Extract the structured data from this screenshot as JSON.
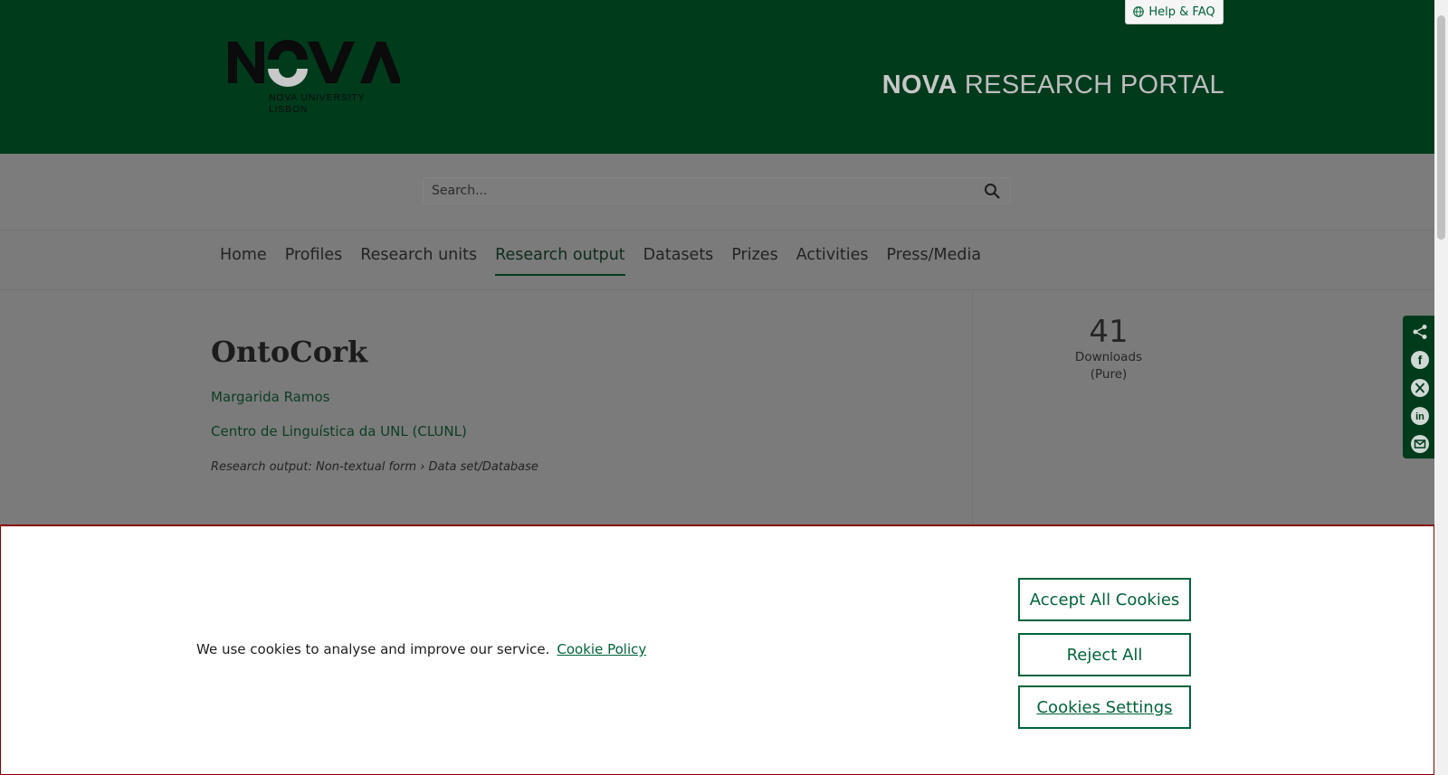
{
  "header": {
    "help_label": "Help & FAQ",
    "logo_text": "NOVA",
    "logo_sub_line1": "NOVA UNIVERSITY",
    "logo_sub_line2": "LISBON",
    "portal_title_bold": "NOVA",
    "portal_title_rest": " RESEARCH PORTAL"
  },
  "search": {
    "placeholder": "Search..."
  },
  "nav": {
    "items": [
      {
        "label": "Home"
      },
      {
        "label": "Profiles"
      },
      {
        "label": "Research units"
      },
      {
        "label": "Research output",
        "active": true
      },
      {
        "label": "Datasets"
      },
      {
        "label": "Prizes"
      },
      {
        "label": "Activities"
      },
      {
        "label": "Press/Media"
      }
    ]
  },
  "output": {
    "title": "OntoCork",
    "author": "Margarida Ramos",
    "unit": "Centro de Linguística da UNL (CLUNL)",
    "type": "Research output: Non-textual form › Data set/Database"
  },
  "metrics": {
    "downloads_count": "41",
    "downloads_label": "Downloads",
    "downloads_source": "(Pure)"
  },
  "share_icons": [
    "share-icon",
    "facebook-icon",
    "x-twitter-icon",
    "linkedin-icon",
    "email-icon"
  ],
  "cookie": {
    "message": "We use cookies to analyse and improve our service.",
    "policy_link": "Cookie Policy",
    "accept_label": "Accept All Cookies",
    "reject_label": "Reject All",
    "settings_label": "Cookies Settings"
  },
  "colors": {
    "brand_green": "#00643a",
    "header_dark_green": "#003b1c",
    "overlay_gray": "#7b7b7b"
  }
}
